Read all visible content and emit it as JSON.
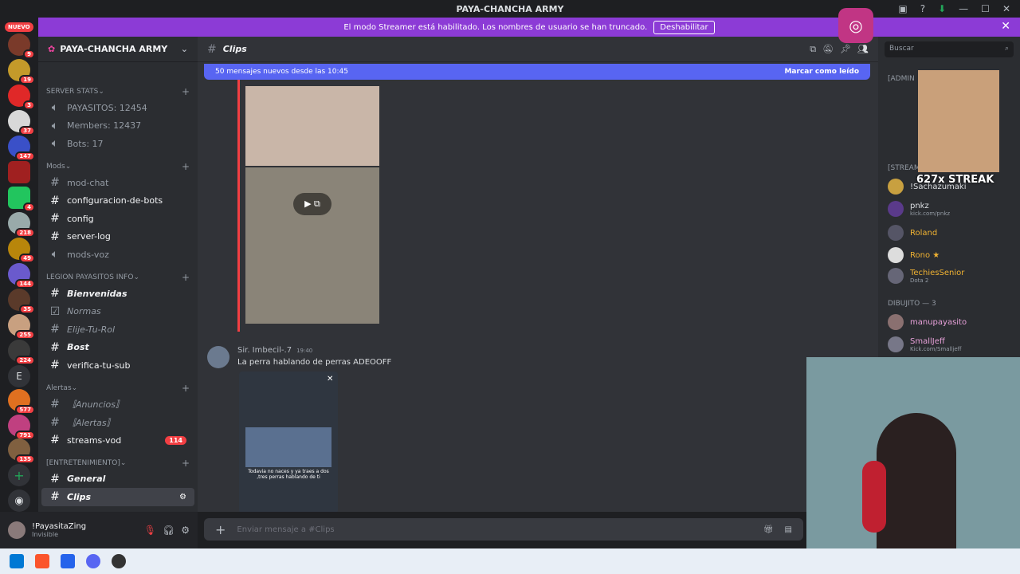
{
  "window": {
    "title": "PAYA-CHANCHA ARMY"
  },
  "streamer_bar": {
    "message": "El modo Streamer está habilitado. Los nombres de usuario se han truncado.",
    "button": "Deshabilitar"
  },
  "guilds": {
    "new_label": "NUEVO",
    "badges": [
      "9",
      "19",
      "3",
      "37",
      "147",
      "4",
      "218",
      "49",
      "144",
      "35",
      "255",
      "224",
      "577",
      "791",
      "135"
    ],
    "letter": "E"
  },
  "server": {
    "name": "PAYA-CHANCHA ARMY",
    "categories": [
      {
        "name": "SERVER STATS",
        "channels": [
          {
            "name": "PAYASITOS: 12454",
            "type": "voice"
          },
          {
            "name": "Members: 12437",
            "type": "voice"
          },
          {
            "name": "Bots: 17",
            "type": "voice"
          }
        ]
      },
      {
        "name": "Mods",
        "channels": [
          {
            "name": "mod-chat",
            "type": "text"
          },
          {
            "name": "configuracion-de-bots",
            "type": "text",
            "bright": true
          },
          {
            "name": "config",
            "type": "text",
            "bright": true
          },
          {
            "name": "server-log",
            "type": "text",
            "bright": true
          },
          {
            "name": "mods-voz",
            "type": "voice"
          }
        ]
      },
      {
        "name": "LEGION PAYASITOS INFO",
        "channels": [
          {
            "name": "Bienvenidas",
            "type": "text",
            "bright": true
          },
          {
            "name": "Normas",
            "type": "rules"
          },
          {
            "name": "Elije-Tu-Rol",
            "type": "text"
          },
          {
            "name": "Bost",
            "type": "text",
            "bright": true
          },
          {
            "name": "verifica-tu-sub",
            "type": "text",
            "bright": true
          }
        ]
      },
      {
        "name": "Alertas",
        "channels": [
          {
            "name": "〚Anuncios〛",
            "type": "text"
          },
          {
            "name": "〚Alertas〛",
            "type": "text"
          },
          {
            "name": "streams-vod",
            "type": "text",
            "bright": true,
            "count": "114"
          }
        ]
      },
      {
        "name": "[ENTRETENIMIENTO]",
        "channels": [
          {
            "name": "General",
            "type": "text",
            "bright": true
          },
          {
            "name": "Clips",
            "type": "text",
            "selected": true
          }
        ]
      }
    ]
  },
  "user": {
    "name": "!PayasitaZing",
    "status": "Invisible"
  },
  "chat": {
    "channel": "Clips",
    "new_messages": "50 mensajes nuevos desde las 10:45",
    "mark_read": "Marcar como leído",
    "message": {
      "author": "Sir. Imbecil-.7",
      "time": "19:40",
      "text": "La perra hablando de perras ADEOOFF"
    },
    "video_caption": "Todavia no naces y ya traes a dos ,tres perras hablando de ti",
    "input_placeholder": "Enviar mensaje a #Clips"
  },
  "members": {
    "search_placeholder": "Buscar",
    "sections": [
      {
        "title": "[ADMIN",
        "items": []
      },
      {
        "title": "[STREAM",
        "items": []
      },
      {
        "title": "DIBUJITO — 3",
        "items": []
      }
    ],
    "list": [
      {
        "name": "!Sachazumaki",
        "sub": ""
      },
      {
        "name": "pnkz",
        "sub": "kick.com/pnkz"
      },
      {
        "name": "Roland",
        "sub": ""
      },
      {
        "name": "Rono ★",
        "sub": ""
      },
      {
        "name": "TechiesSenior",
        "sub": "Dota 2"
      },
      {
        "name": "manupayasito",
        "sub": ""
      },
      {
        "name": "SmallJeff",
        "sub": "Kick.com/Smalljeff"
      }
    ]
  },
  "overlay": {
    "streak": "627x STREAK"
  },
  "colors": {
    "accent": "#5865f2",
    "streamer": "#8c3bd6",
    "danger": "#f23f43"
  }
}
